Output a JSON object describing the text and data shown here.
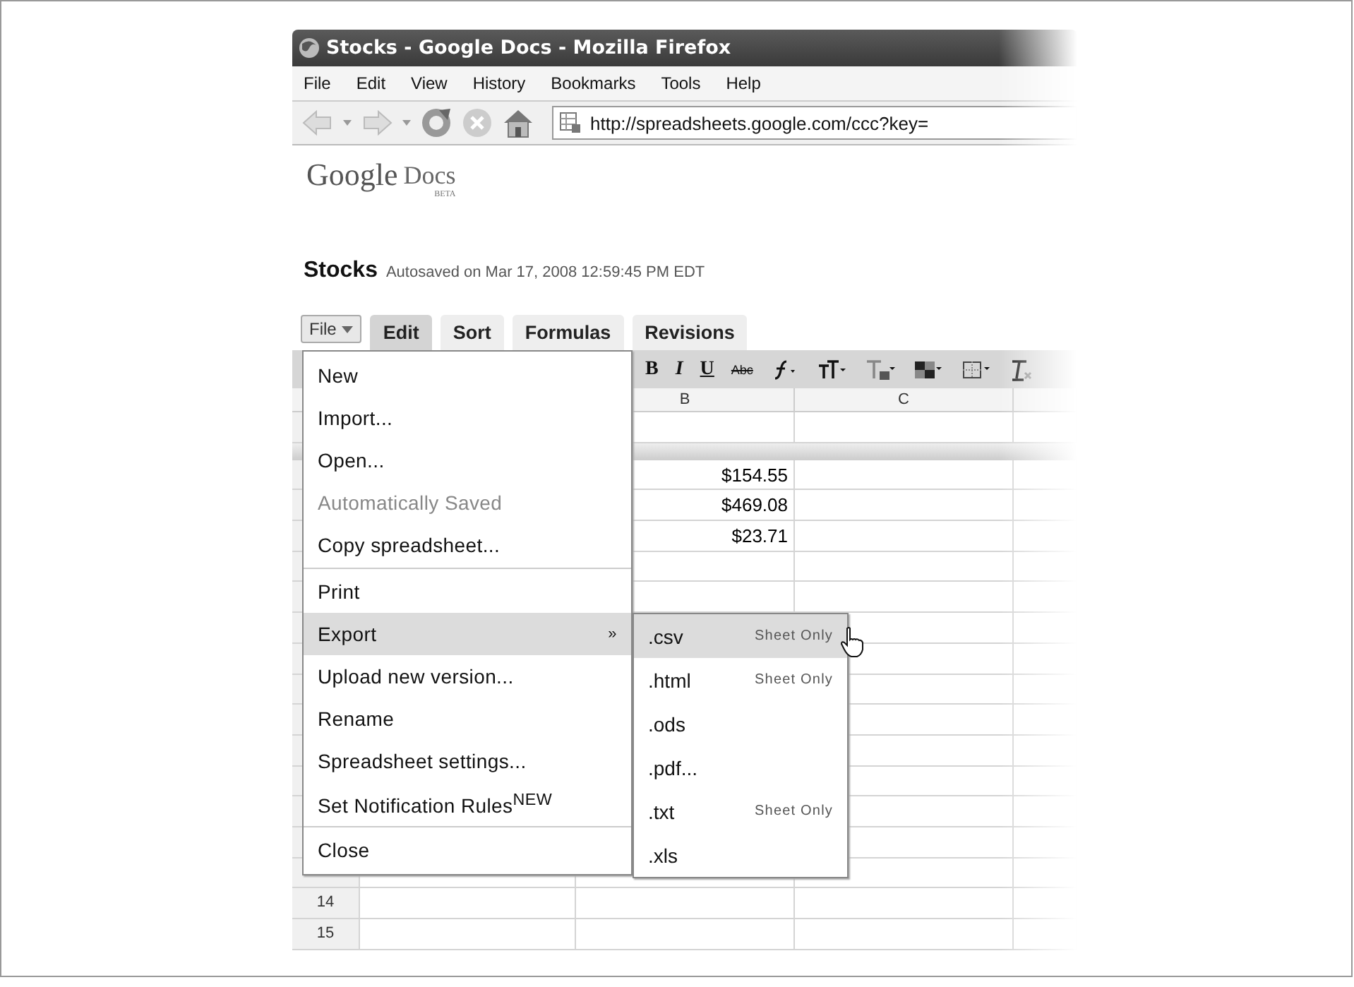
{
  "window": {
    "title": "Stocks - Google Docs - Mozilla Firefox"
  },
  "menu_bar": [
    "File",
    "Edit",
    "View",
    "History",
    "Bookmarks",
    "Tools",
    "Help"
  ],
  "address_bar": {
    "value": "http://spreadsheets.google.com/ccc?key="
  },
  "logo": {
    "name": "Google",
    "product": "Docs",
    "badge": "BETA"
  },
  "document": {
    "title": "Stocks",
    "status": "Autosaved on Mar 17, 2008 12:59:45 PM EDT"
  },
  "file_button": {
    "label": "File",
    "open": true
  },
  "tabs": [
    {
      "label": "Edit",
      "selected": true
    },
    {
      "label": "Sort",
      "selected": false
    },
    {
      "label": "Formulas",
      "selected": false
    },
    {
      "label": "Revisions",
      "selected": false
    }
  ],
  "format_toolbar": [
    {
      "kind": "text",
      "label": "B"
    },
    {
      "kind": "text",
      "label": "I"
    },
    {
      "kind": "text",
      "label": "U"
    },
    {
      "kind": "text",
      "label": "Abc"
    },
    {
      "kind": "function"
    },
    {
      "kind": "text-size"
    },
    {
      "kind": "text-color"
    },
    {
      "kind": "fill-color"
    },
    {
      "kind": "borders"
    },
    {
      "kind": "clear-format"
    }
  ],
  "sheet": {
    "columns": [
      "B",
      "C"
    ],
    "rows": [
      {
        "b": "$154.55"
      },
      {
        "b": "$469.08"
      },
      {
        "b": "$23.71"
      },
      {
        "number": "14"
      },
      {
        "number": "15"
      }
    ]
  },
  "file_menu": [
    {
      "label": "New",
      "disabled": false,
      "selected": false
    },
    {
      "label": "Import...",
      "disabled": false,
      "selected": false
    },
    {
      "label": "Open...",
      "disabled": false,
      "selected": false
    },
    {
      "label": "Automatically Saved",
      "disabled": true,
      "selected": false
    },
    {
      "label": "Copy spreadsheet...",
      "disabled": false,
      "selected": false,
      "separator_after": true
    },
    {
      "label": "Print",
      "disabled": false,
      "selected": false
    },
    {
      "label": "Export",
      "disabled": false,
      "selected": true,
      "submenu_arrow": "»"
    },
    {
      "label": "Upload new version...",
      "disabled": false,
      "selected": false
    },
    {
      "label": "Rename",
      "disabled": false,
      "selected": false
    },
    {
      "label": "Spreadsheet settings...",
      "disabled": false,
      "selected": false
    },
    {
      "label": "Set Notification Rules$^{NEW}$",
      "disabled": false,
      "selected": false,
      "separator_after": true
    },
    {
      "label": "Close",
      "disabled": false,
      "selected": false
    }
  ],
  "export_submenu": [
    {
      "label": ".csv",
      "note": "Sheet Only",
      "selected": true
    },
    {
      "label": ".html",
      "note": "Sheet Only",
      "selected": false
    },
    {
      "label": ".ods",
      "selected": false
    },
    {
      "label": ".pdf...",
      "selected": false
    },
    {
      "label": ".txt",
      "note": "Sheet Only",
      "selected": false
    },
    {
      "label": ".xls",
      "selected": false
    }
  ]
}
